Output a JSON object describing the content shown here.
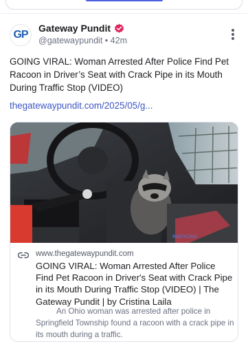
{
  "post": {
    "author_name": "Gateway Pundit",
    "avatar_text": "GP",
    "handle": "@gatewaypundit",
    "separator": "•",
    "time": "42m",
    "verified_badge": "verified-badge-icon",
    "text": "GOING VIRAL: Woman Arrested After Police Find Pet Racoon in Driver’s Seat with Crack Pipe in its Mouth During Traffic Stop (VIDEO)",
    "link_text": "thegatewaypundit.com/2025/05/g..."
  },
  "card": {
    "domain": "www.thegatewaypundit.com",
    "title": "GOING VIRAL: Woman Arrested After Police Find Pet Racoon in Driver's Seat with Crack Pipe in its Mouth During Traffic Stop (VIDEO) | The Gateway Pundit | by Cristina Laila",
    "description": "An Ohio woman was arrested after police in Springfield Township found a racoon with a crack pipe in its mouth during a traffic."
  },
  "colors": {
    "link": "#3e56c5",
    "badge": "#e0245e",
    "accent": "#4a5fe0"
  }
}
